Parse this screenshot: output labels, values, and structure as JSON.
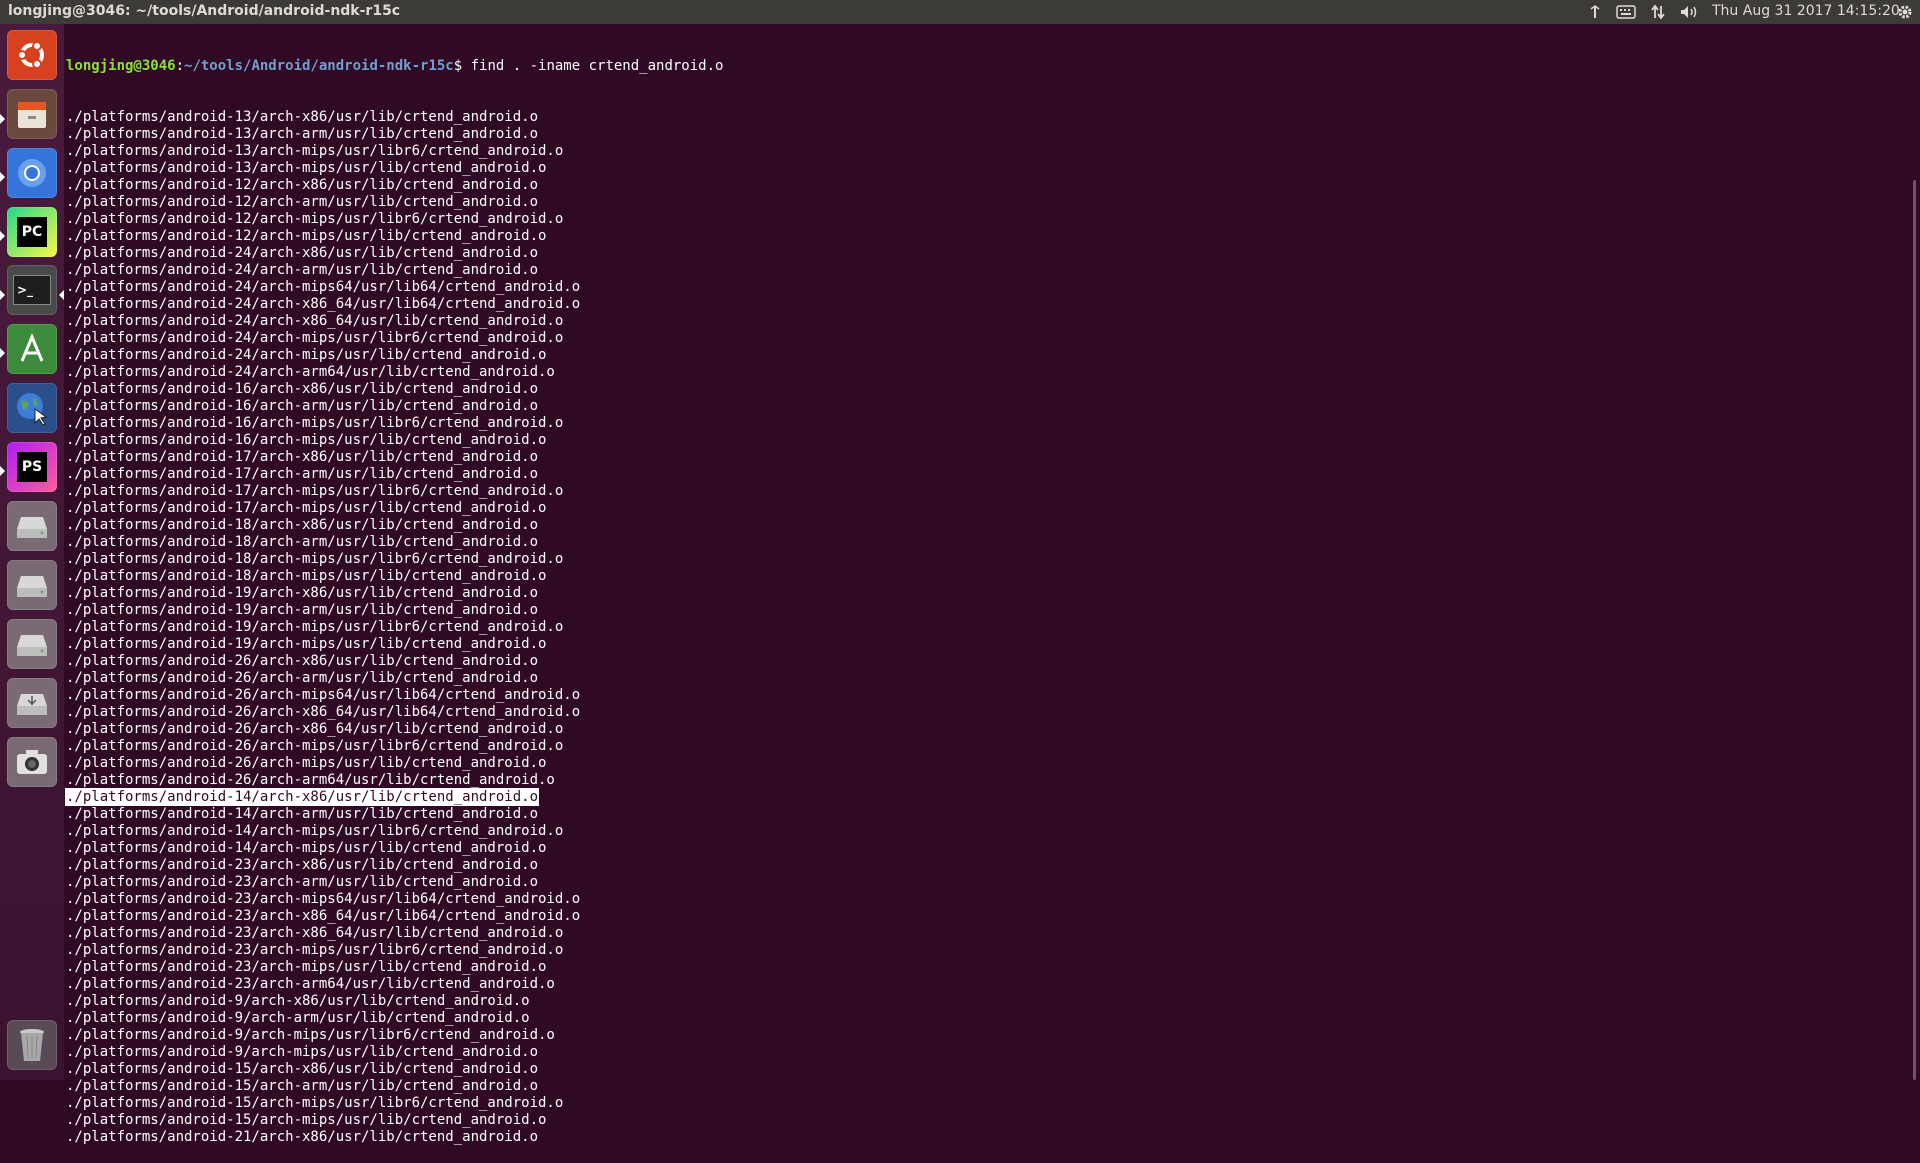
{
  "window": {
    "title": "longjing@3046: ~/tools/Android/android-ndk-r15c"
  },
  "panel": {
    "clock": "Thu Aug 31 2017 14:15:20",
    "indicators": [
      "network-indicator-icon",
      "keyboard-icon",
      "transfer-arrows-icon",
      "volume-icon",
      "settings-gear-icon"
    ]
  },
  "launcher": {
    "items": [
      {
        "name": "ubuntu-dash",
        "icon": "ubuntu-logo-icon"
      },
      {
        "name": "files",
        "icon": "file-cabinet-icon"
      },
      {
        "name": "chromium",
        "icon": "chromium-icon"
      },
      {
        "name": "pycharm",
        "icon": "pycharm-icon",
        "label": "PC"
      },
      {
        "name": "terminal",
        "icon": "terminal-icon",
        "label": ">_"
      },
      {
        "name": "android-studio",
        "icon": "android-studio-icon"
      },
      {
        "name": "web-browser",
        "icon": "globe-cursor-icon"
      },
      {
        "name": "phpstorm",
        "icon": "phpstorm-icon",
        "label": "PS"
      },
      {
        "name": "drive-1",
        "icon": "hard-drive-icon"
      },
      {
        "name": "drive-2",
        "icon": "hard-drive-icon"
      },
      {
        "name": "drive-3",
        "icon": "hard-drive-icon"
      },
      {
        "name": "usb-drive",
        "icon": "usb-drive-icon"
      },
      {
        "name": "camera",
        "icon": "camera-icon"
      },
      {
        "name": "trash",
        "icon": "trash-icon"
      }
    ]
  },
  "colors": {
    "background": "#300a24",
    "prompt_user": "#8ae234",
    "prompt_path": "#729fcf",
    "text": "#ffffff"
  },
  "terminal": {
    "prompt_user": "longjing@3046",
    "prompt_sep": ":",
    "prompt_path": "~/tools/Android/android-ndk-r15c",
    "prompt_symbol": "$ ",
    "command": "find . -iname crtend_android.o",
    "selected_index": 40,
    "lines": [
      "./platforms/android-13/arch-x86/usr/lib/crtend_android.o",
      "./platforms/android-13/arch-arm/usr/lib/crtend_android.o",
      "./platforms/android-13/arch-mips/usr/libr6/crtend_android.o",
      "./platforms/android-13/arch-mips/usr/lib/crtend_android.o",
      "./platforms/android-12/arch-x86/usr/lib/crtend_android.o",
      "./platforms/android-12/arch-arm/usr/lib/crtend_android.o",
      "./platforms/android-12/arch-mips/usr/libr6/crtend_android.o",
      "./platforms/android-12/arch-mips/usr/lib/crtend_android.o",
      "./platforms/android-24/arch-x86/usr/lib/crtend_android.o",
      "./platforms/android-24/arch-arm/usr/lib/crtend_android.o",
      "./platforms/android-24/arch-mips64/usr/lib64/crtend_android.o",
      "./platforms/android-24/arch-x86_64/usr/lib64/crtend_android.o",
      "./platforms/android-24/arch-x86_64/usr/lib/crtend_android.o",
      "./platforms/android-24/arch-mips/usr/libr6/crtend_android.o",
      "./platforms/android-24/arch-mips/usr/lib/crtend_android.o",
      "./platforms/android-24/arch-arm64/usr/lib/crtend_android.o",
      "./platforms/android-16/arch-x86/usr/lib/crtend_android.o",
      "./platforms/android-16/arch-arm/usr/lib/crtend_android.o",
      "./platforms/android-16/arch-mips/usr/libr6/crtend_android.o",
      "./platforms/android-16/arch-mips/usr/lib/crtend_android.o",
      "./platforms/android-17/arch-x86/usr/lib/crtend_android.o",
      "./platforms/android-17/arch-arm/usr/lib/crtend_android.o",
      "./platforms/android-17/arch-mips/usr/libr6/crtend_android.o",
      "./platforms/android-17/arch-mips/usr/lib/crtend_android.o",
      "./platforms/android-18/arch-x86/usr/lib/crtend_android.o",
      "./platforms/android-18/arch-arm/usr/lib/crtend_android.o",
      "./platforms/android-18/arch-mips/usr/libr6/crtend_android.o",
      "./platforms/android-18/arch-mips/usr/lib/crtend_android.o",
      "./platforms/android-19/arch-x86/usr/lib/crtend_android.o",
      "./platforms/android-19/arch-arm/usr/lib/crtend_android.o",
      "./platforms/android-19/arch-mips/usr/libr6/crtend_android.o",
      "./platforms/android-19/arch-mips/usr/lib/crtend_android.o",
      "./platforms/android-26/arch-x86/usr/lib/crtend_android.o",
      "./platforms/android-26/arch-arm/usr/lib/crtend_android.o",
      "./platforms/android-26/arch-mips64/usr/lib64/crtend_android.o",
      "./platforms/android-26/arch-x86_64/usr/lib64/crtend_android.o",
      "./platforms/android-26/arch-x86_64/usr/lib/crtend_android.o",
      "./platforms/android-26/arch-mips/usr/libr6/crtend_android.o",
      "./platforms/android-26/arch-mips/usr/lib/crtend_android.o",
      "./platforms/android-26/arch-arm64/usr/lib/crtend_android.o",
      "./platforms/android-14/arch-x86/usr/lib/crtend_android.o",
      "./platforms/android-14/arch-arm/usr/lib/crtend_android.o",
      "./platforms/android-14/arch-mips/usr/libr6/crtend_android.o",
      "./platforms/android-14/arch-mips/usr/lib/crtend_android.o",
      "./platforms/android-23/arch-x86/usr/lib/crtend_android.o",
      "./platforms/android-23/arch-arm/usr/lib/crtend_android.o",
      "./platforms/android-23/arch-mips64/usr/lib64/crtend_android.o",
      "./platforms/android-23/arch-x86_64/usr/lib64/crtend_android.o",
      "./platforms/android-23/arch-x86_64/usr/lib/crtend_android.o",
      "./platforms/android-23/arch-mips/usr/libr6/crtend_android.o",
      "./platforms/android-23/arch-mips/usr/lib/crtend_android.o",
      "./platforms/android-23/arch-arm64/usr/lib/crtend_android.o",
      "./platforms/android-9/arch-x86/usr/lib/crtend_android.o",
      "./platforms/android-9/arch-arm/usr/lib/crtend_android.o",
      "./platforms/android-9/arch-mips/usr/libr6/crtend_android.o",
      "./platforms/android-9/arch-mips/usr/lib/crtend_android.o",
      "./platforms/android-15/arch-x86/usr/lib/crtend_android.o",
      "./platforms/android-15/arch-arm/usr/lib/crtend_android.o",
      "./platforms/android-15/arch-mips/usr/libr6/crtend_android.o",
      "./platforms/android-15/arch-mips/usr/lib/crtend_android.o",
      "./platforms/android-21/arch-x86/usr/lib/crtend_android.o"
    ]
  }
}
